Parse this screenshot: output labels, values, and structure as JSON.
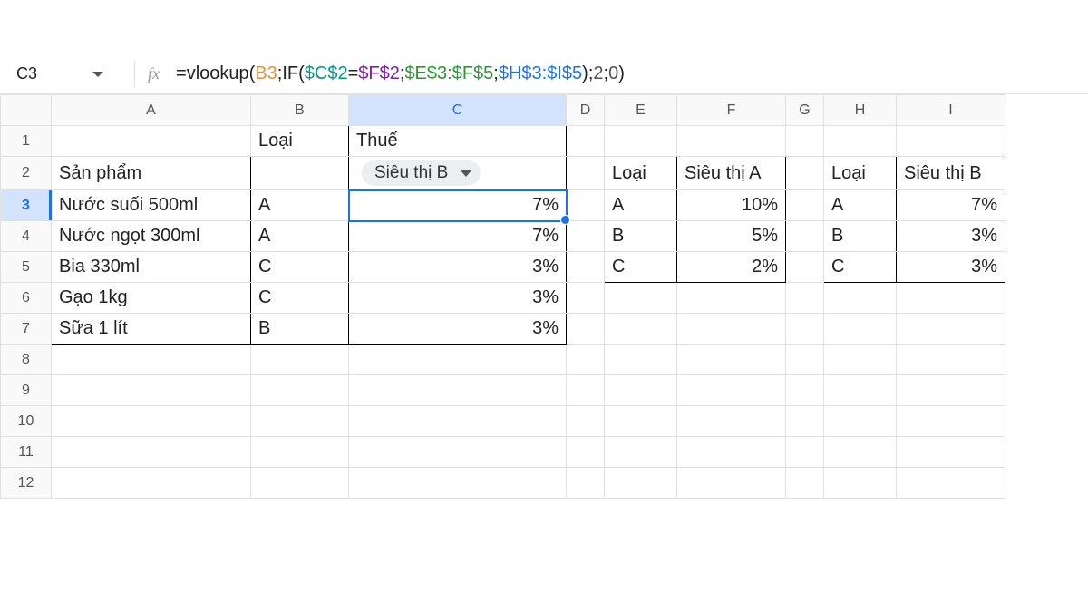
{
  "active_cell": "C3",
  "formula": {
    "parts": [
      {
        "t": "=",
        "c": "tok-plain"
      },
      {
        "t": "vlookup",
        "c": "tok-plain"
      },
      {
        "t": "(",
        "c": "tok-plain"
      },
      {
        "t": "B3",
        "c": "tok-orange"
      },
      {
        "t": ";",
        "c": "tok-plain"
      },
      {
        "t": "IF",
        "c": "tok-plain"
      },
      {
        "t": "(",
        "c": "tok-plain"
      },
      {
        "t": "$C$2",
        "c": "tok-teal"
      },
      {
        "t": "=",
        "c": "tok-plain"
      },
      {
        "t": "$F$2",
        "c": "tok-purple"
      },
      {
        "t": ";",
        "c": "tok-plain"
      },
      {
        "t": "$E$3:$F$5",
        "c": "tok-green"
      },
      {
        "t": ";",
        "c": "tok-plain"
      },
      {
        "t": "$H$3:$I$5",
        "c": "tok-blue"
      },
      {
        "t": ")",
        "c": "tok-plain"
      },
      {
        "t": ";",
        "c": "tok-plain"
      },
      {
        "t": "2",
        "c": "tok-gray"
      },
      {
        "t": ";",
        "c": "tok-plain"
      },
      {
        "t": "0",
        "c": "tok-gray"
      },
      {
        "t": ")",
        "c": "tok-plain"
      }
    ]
  },
  "columns": [
    "A",
    "B",
    "C",
    "D",
    "E",
    "F",
    "G",
    "H",
    "I"
  ],
  "headers": {
    "B1": "Loại",
    "C1": "Thuế",
    "A2": "Sản phẩm",
    "C2_chip": "Siêu thị B",
    "E2": "Loại",
    "F2": "Siêu thị A",
    "H2": "Loại",
    "I2": "Siêu thị B"
  },
  "products": [
    {
      "name": "Nước suối 500ml",
      "type": "A",
      "tax": "7%"
    },
    {
      "name": "Nước ngọt 300ml",
      "type": "A",
      "tax": "7%"
    },
    {
      "name": "Bia 330ml",
      "type": "C",
      "tax": "3%"
    },
    {
      "name": "Gạo 1kg",
      "type": "C",
      "tax": "3%"
    },
    {
      "name": "Sữa 1 lít",
      "type": "B",
      "tax": "3%"
    }
  ],
  "lookupA": [
    {
      "k": "A",
      "v": "10%"
    },
    {
      "k": "B",
      "v": "5%"
    },
    {
      "k": "C",
      "v": "2%"
    }
  ],
  "lookupB": [
    {
      "k": "A",
      "v": "7%"
    },
    {
      "k": "B",
      "v": "3%"
    },
    {
      "k": "C",
      "v": "3%"
    }
  ],
  "row_count": 12
}
